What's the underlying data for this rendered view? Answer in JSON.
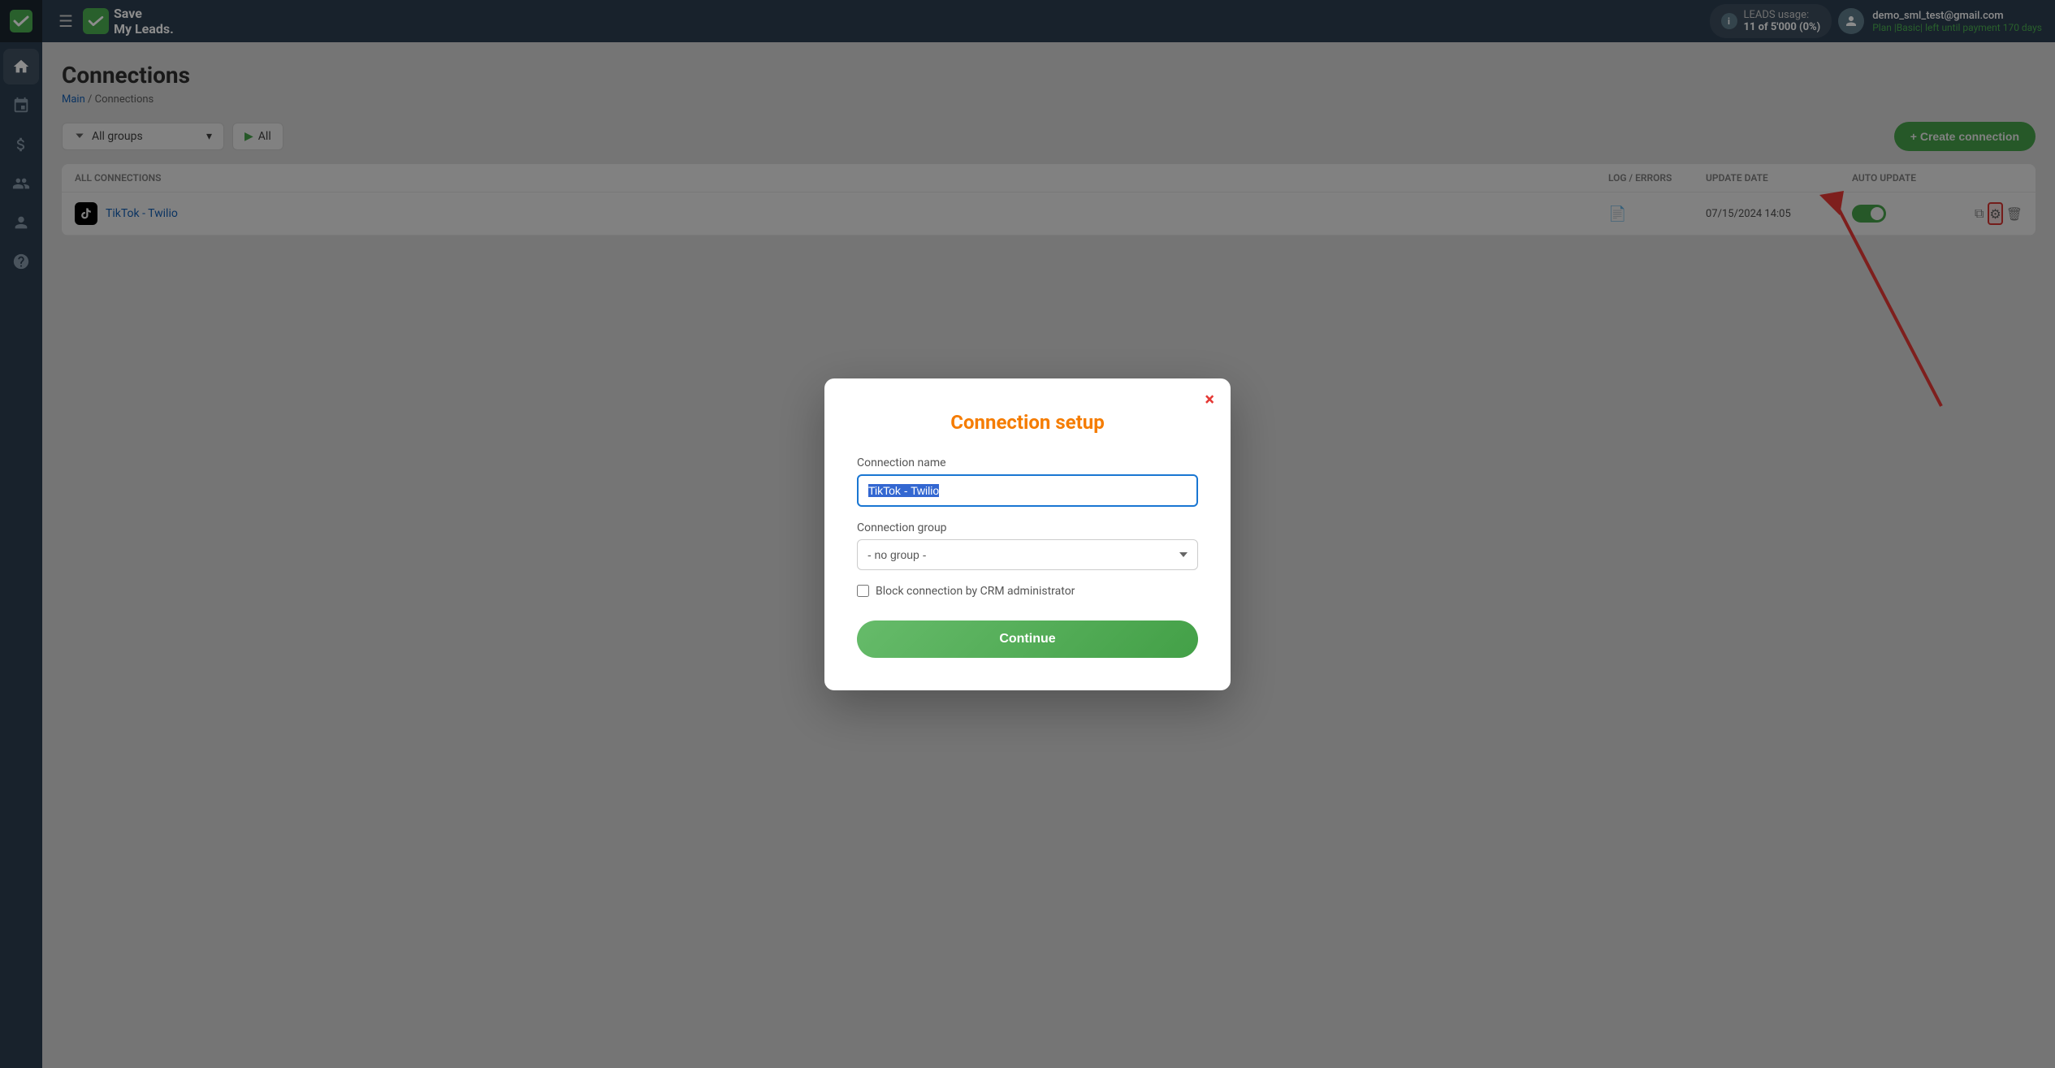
{
  "app": {
    "name": "Save My Leads.",
    "logo_text": "Save\nMy Leads."
  },
  "topbar": {
    "hamburger": "☰",
    "leads_label": "LEADS usage:",
    "leads_count": "11 of 5'000 (0%)",
    "user_email": "demo_sml_test@gmail.com",
    "user_plan": "Plan |Basic| left until payment",
    "user_days": "170 days"
  },
  "page": {
    "title": "Connections",
    "breadcrumb_main": "Main",
    "breadcrumb_sep": "/",
    "breadcrumb_current": "Connections"
  },
  "toolbar": {
    "group_label": "All groups",
    "all_status_label": "All",
    "create_label": "+ Create connection"
  },
  "table": {
    "columns": {
      "all_connections": "ALL CONNECTIONS",
      "log_errors": "LOG / ERRORS",
      "update_date": "UPDATE DATE",
      "auto_update": "AUTO UPDATE"
    },
    "rows": [
      {
        "name": "TikTok - Twilio",
        "log": "📄",
        "update_date": "07/15/2024 14:05",
        "auto_update": true
      }
    ]
  },
  "modal": {
    "title": "Connection setup",
    "close_icon": "×",
    "connection_name_label": "Connection name",
    "connection_name_value": "TikTok - Twilio",
    "connection_group_label": "Connection group",
    "connection_group_value": "- no group -",
    "group_options": [
      "- no group -"
    ],
    "checkbox_label": "Block connection by CRM administrator",
    "continue_label": "Continue"
  },
  "sidebar": {
    "items": [
      {
        "icon": "home",
        "label": "Home"
      },
      {
        "icon": "layers",
        "label": "Connections"
      },
      {
        "icon": "dollar",
        "label": "Billing"
      },
      {
        "icon": "users",
        "label": "Users"
      },
      {
        "icon": "user",
        "label": "Profile"
      },
      {
        "icon": "help",
        "label": "Help"
      }
    ]
  }
}
